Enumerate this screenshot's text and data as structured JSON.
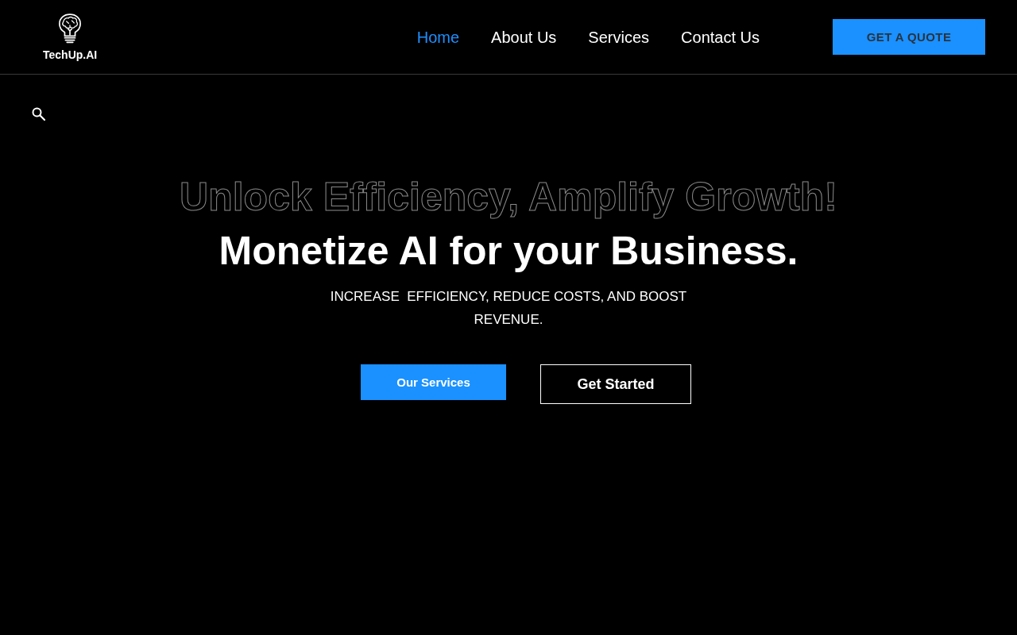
{
  "header": {
    "logo": {
      "text": "TechUp.AI"
    },
    "nav": [
      {
        "label": "Home",
        "selected": true
      },
      {
        "label": "About Us",
        "selected": false
      },
      {
        "label": "Services",
        "selected": false
      },
      {
        "label": "Contact Us",
        "selected": false
      }
    ],
    "cta": {
      "label": "GET A QUOTE"
    }
  },
  "hero": {
    "headline_outline": "Unlock Efficiency, Amplify Growth!",
    "headline": "Monetize AI for your Business.",
    "subtitle": "INCREASE  EFFICIENCY, REDUCE COSTS, AND BOOST REVENUE.",
    "buttons": [
      {
        "label": "Our Services",
        "kind": "filled"
      },
      {
        "label": "Get Started",
        "kind": "outline"
      }
    ]
  }
}
